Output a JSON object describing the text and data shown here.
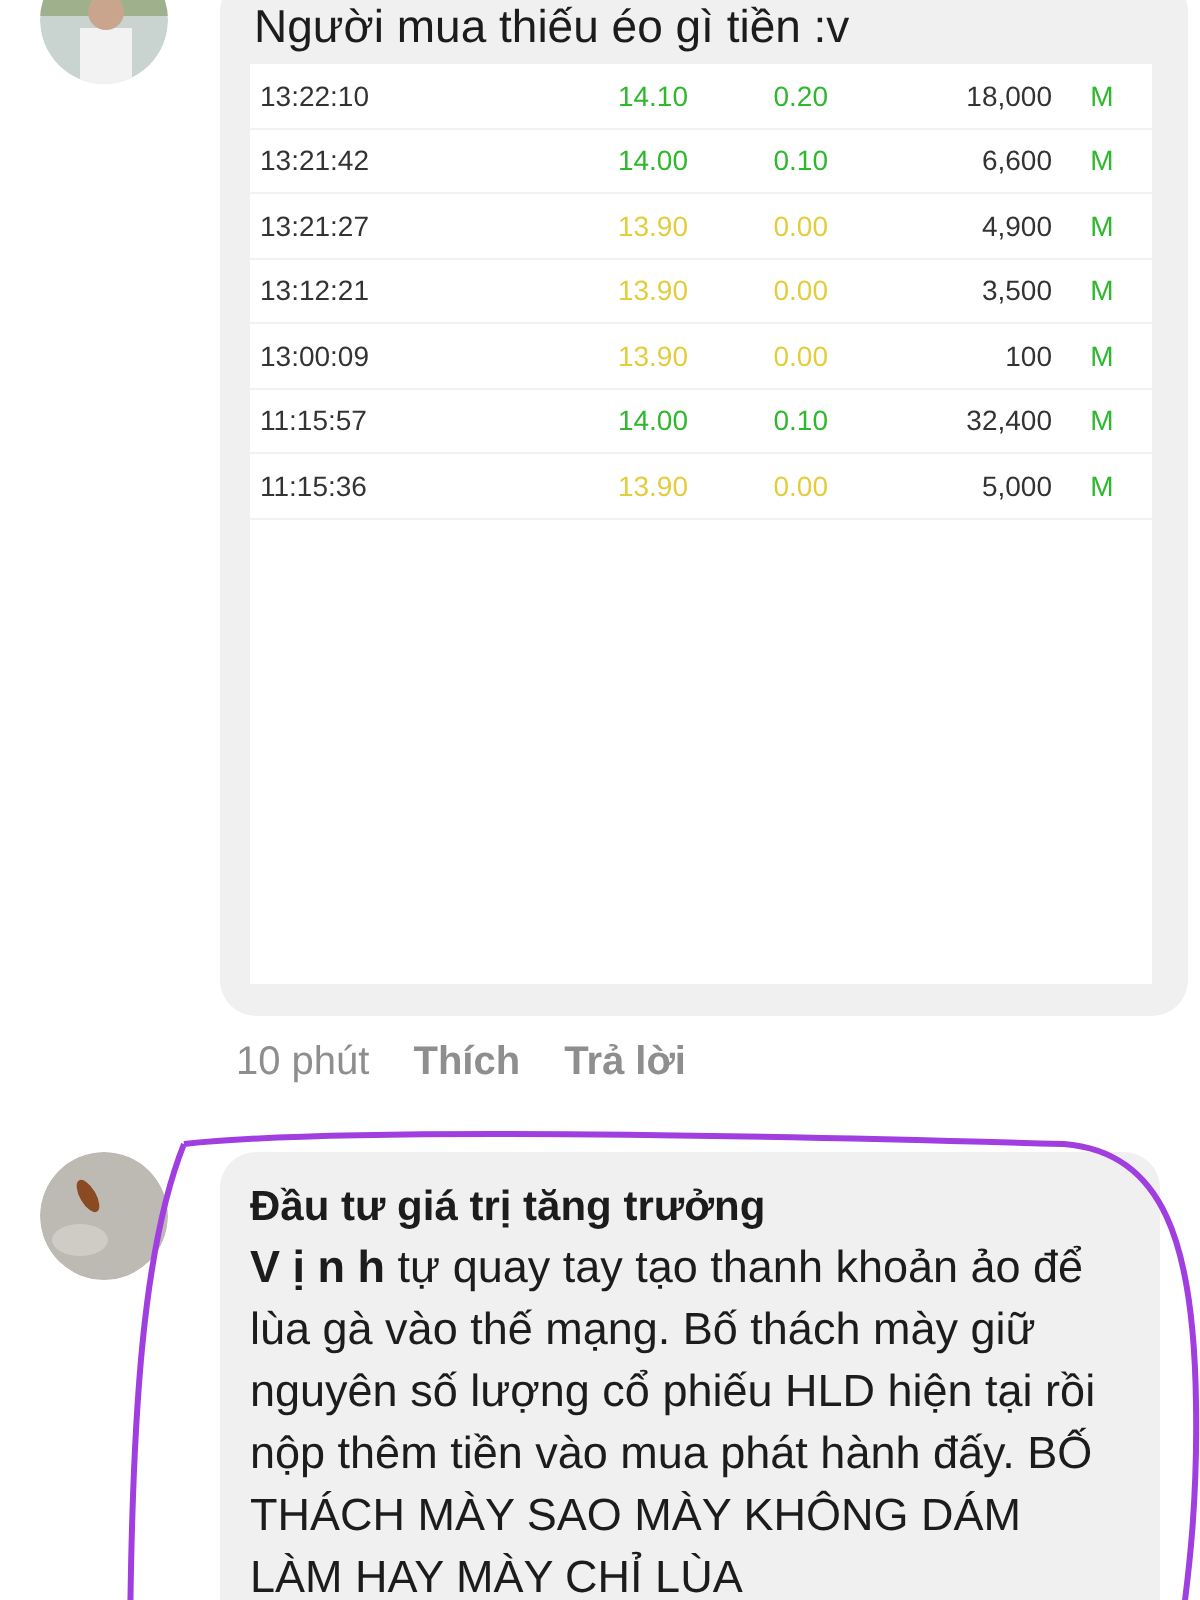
{
  "comments": [
    {
      "kind": "table",
      "text": "Người mua thiếu éo gì tiền :v",
      "trades": [
        {
          "time": "13:22:10",
          "price": "14.10",
          "change": "0.20",
          "volume": "18,000",
          "side": "M",
          "color": "#2eb82e"
        },
        {
          "time": "13:21:42",
          "price": "14.00",
          "change": "0.10",
          "volume": "6,600",
          "side": "M",
          "color": "#2eb82e"
        },
        {
          "time": "13:21:27",
          "price": "13.90",
          "change": "0.00",
          "volume": "4,900",
          "side": "M",
          "color": "#e3cd3d"
        },
        {
          "time": "13:12:21",
          "price": "13.90",
          "change": "0.00",
          "volume": "3,500",
          "side": "M",
          "color": "#e3cd3d"
        },
        {
          "time": "13:00:09",
          "price": "13.90",
          "change": "0.00",
          "volume": "100",
          "side": "M",
          "color": "#e3cd3d"
        },
        {
          "time": "11:15:57",
          "price": "14.00",
          "change": "0.10",
          "volume": "32,400",
          "side": "M",
          "color": "#2eb82e"
        },
        {
          "time": "11:15:36",
          "price": "13.90",
          "change": "0.00",
          "volume": "5,000",
          "side": "M",
          "color": "#e3cd3d"
        }
      ],
      "time": "10 phút",
      "like": "Thích",
      "reply": "Trả lời"
    },
    {
      "kind": "text",
      "author": "Đầu tư giá trị tăng trưởng",
      "text": "**V ị n h**  tự quay tay tạo thanh khoản ảo để lùa gà vào thế mạng. Bố thách mày giữ nguyên số lượng cổ phiếu HLD hiện tại rồi nộp thêm tiền vào mua phát hành đấy. BỐ THÁCH MÀY SAO MÀY KHÔNG DÁM LÀM HAY MÀY CHỈ LÙA",
      "highlighted": true
    }
  ]
}
